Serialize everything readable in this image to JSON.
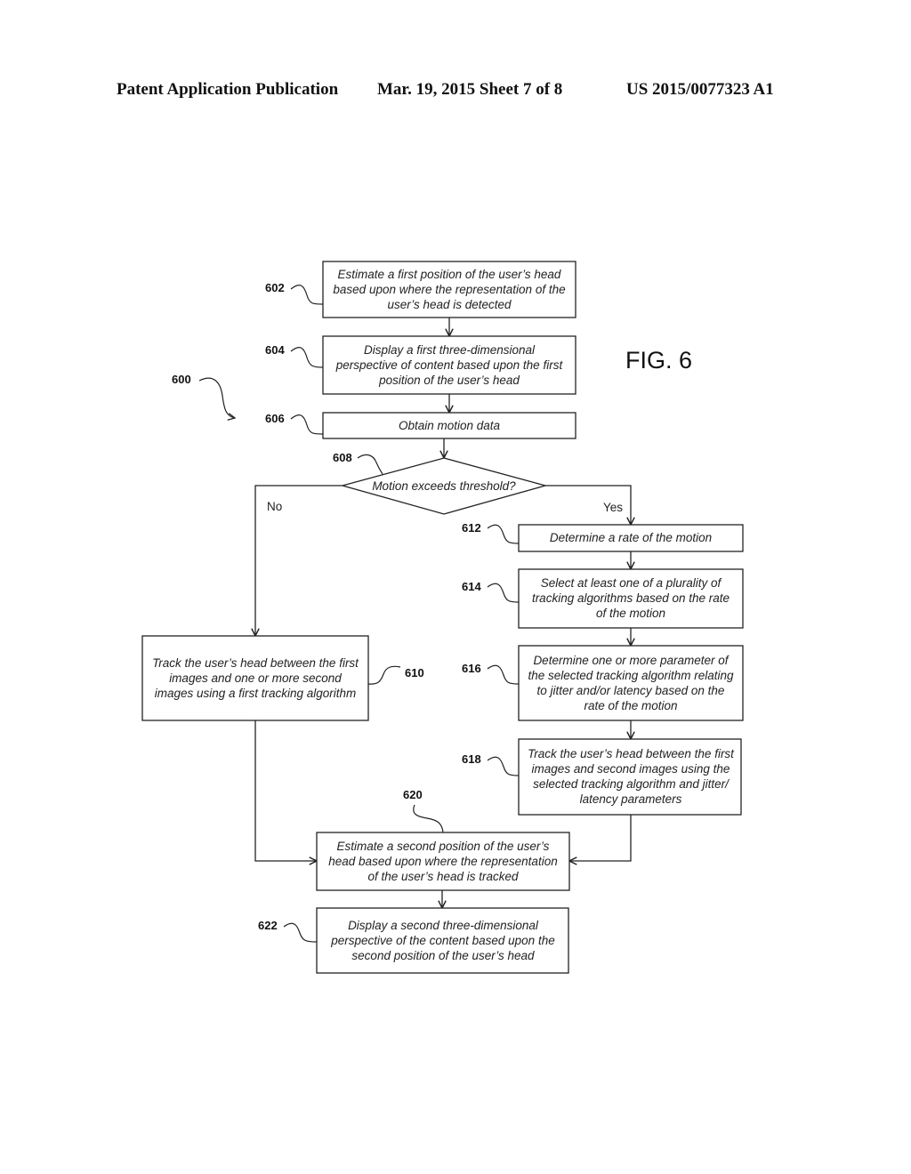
{
  "header": {
    "publication": "Patent Application Publication",
    "date_sheet": "Mar. 19, 2015  Sheet 7 of 8",
    "number": "US 2015/0077323 A1"
  },
  "figure": {
    "label": "FIG. 6",
    "ref": "600"
  },
  "steps": [
    {
      "ref": "602",
      "lines": [
        "Estimate a first position of the user’s head",
        "based upon where the representation of the",
        "user’s head is detected"
      ]
    },
    {
      "ref": "604",
      "lines": [
        "Display a first three-dimensional",
        "perspective of content based upon the first",
        "position of the user’s head"
      ]
    },
    {
      "ref": "606",
      "lines": [
        "Obtain motion data"
      ]
    },
    {
      "ref": "608",
      "lines": [
        "Motion exceeds threshold?"
      ]
    },
    {
      "ref": "610",
      "lines": [
        "Track the user’s head between the first",
        "images and one or more second",
        "images using a first tracking algorithm"
      ]
    },
    {
      "ref": "612",
      "lines": [
        "Determine a rate of the motion"
      ]
    },
    {
      "ref": "614",
      "lines": [
        "Select at least one of a plurality of",
        "tracking algorithms based on the rate",
        "of the motion"
      ]
    },
    {
      "ref": "616",
      "lines": [
        "Determine one or more parameter of",
        "the selected tracking algorithm relating",
        "to jitter and/or latency based on the",
        "rate of the motion"
      ]
    },
    {
      "ref": "618",
      "lines": [
        "Track the user’s head between the first",
        "images and second images using the",
        "selected tracking algorithm and jitter/",
        "latency parameters"
      ]
    },
    {
      "ref": "620",
      "lines": [
        "Estimate a second position of the user’s",
        "head based upon where the representation",
        "of the user’s head is tracked"
      ]
    },
    {
      "ref": "622",
      "lines": [
        "Display a second three-dimensional",
        "perspective of the content based upon the",
        "second position of the user’s head"
      ]
    }
  ],
  "branches": {
    "no": "No",
    "yes": "Yes"
  }
}
